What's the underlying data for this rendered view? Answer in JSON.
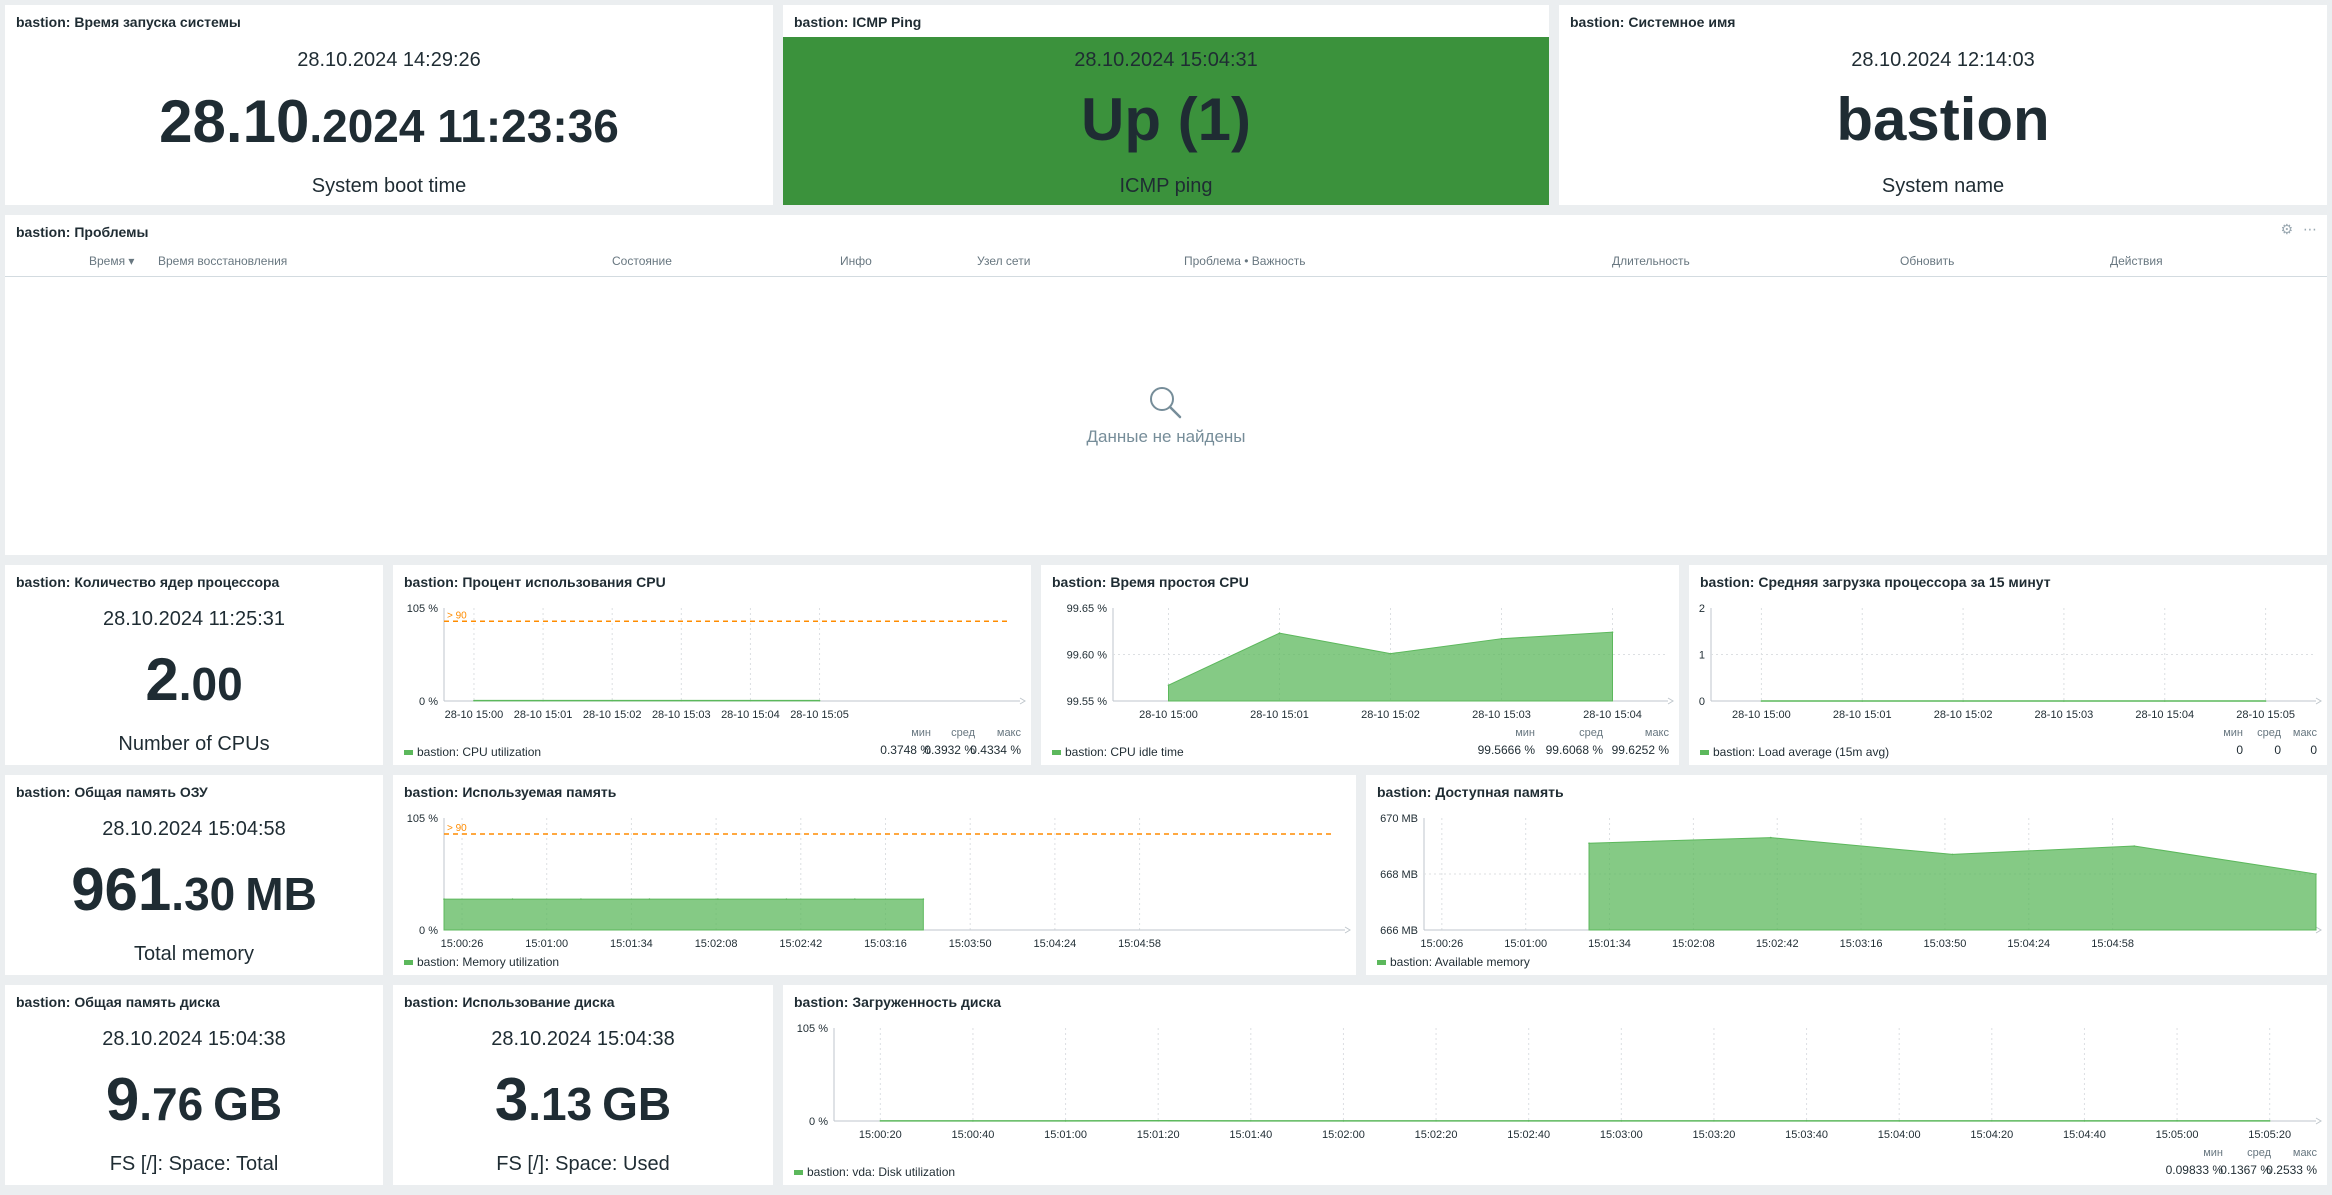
{
  "host": "bastion",
  "colors": {
    "accent_green": "#3b923c",
    "series_green": "#5cb85c",
    "threshold_orange": "#ff8c00"
  },
  "boot": {
    "title": "bastion: Время запуска системы",
    "ts": "28.10.2024 14:29:26",
    "big_main": "28.10",
    "big_small": ".2024 11:23:36",
    "desc": "System boot time"
  },
  "ping": {
    "title": "bastion: ICMP Ping",
    "ts": "28.10.2024 15:04:31",
    "big_main": "Up (1)",
    "desc": "ICMP ping"
  },
  "sysname": {
    "title": "bastion: Системное имя",
    "ts": "28.10.2024 12:14:03",
    "big_main": "bastion",
    "desc": "System name"
  },
  "problems": {
    "title": "bastion: Проблемы",
    "columns": {
      "time": "Время ▾",
      "recovery": "Время восстановления",
      "status": "Состояние",
      "info": "Инфо",
      "host": "Узел сети",
      "problem": "Проблема • Важность",
      "duration": "Длительность",
      "update": "Обновить",
      "actions": "Действия"
    },
    "empty": "Данные не найдены",
    "icons": [
      "gear-icon",
      "more-icon"
    ]
  },
  "cpu_count": {
    "title": "bastion: Количество ядер процессора",
    "ts": "28.10.2024 11:25:31",
    "big_main": "2",
    "big_small": ".00",
    "desc": "Number of CPUs"
  },
  "cpu_util": {
    "title": "bastion: Процент использования CPU",
    "legend": "bastion: CPU utilization",
    "stats": {
      "min_label": "мин",
      "avg_label": "сред",
      "max_label": "макс",
      "min": "0.3748 %",
      "avg": "0.3932 %",
      "max": "0.4334 %"
    }
  },
  "cpu_idle": {
    "title": "bastion: Время простоя CPU",
    "legend": "bastion: CPU idle time",
    "stats": {
      "min_label": "мин",
      "avg_label": "сред",
      "max_label": "макс",
      "min": "99.5666 %",
      "avg": "99.6068 %",
      "max": "99.6252 %"
    }
  },
  "load15": {
    "title": "bastion: Средняя загрузка процессора за 15 минут",
    "legend": "bastion: Load average (15m avg)",
    "stats": {
      "min_label": "мин",
      "avg_label": "сред",
      "max_label": "макс",
      "min": "0",
      "avg": "0",
      "max": "0"
    }
  },
  "total_mem": {
    "title": "bastion: Общая память ОЗУ",
    "ts": "28.10.2024 15:04:58",
    "big_main": "961",
    "big_small": ".30",
    "big_unit": "MB",
    "desc": "Total memory"
  },
  "mem_used": {
    "title": "bastion: Используемая память",
    "legend": "bastion: Memory utilization"
  },
  "mem_avail": {
    "title": "bastion: Доступная память",
    "legend": "bastion: Available memory"
  },
  "disk_total": {
    "title": "bastion: Общая память диска",
    "ts": "28.10.2024 15:04:38",
    "big_main": "9",
    "big_small": ".76",
    "big_unit": "GB",
    "desc": "FS [/]: Space: Total"
  },
  "disk_used": {
    "title": "bastion: Использование диска",
    "ts": "28.10.2024 15:04:38",
    "big_main": "3",
    "big_small": ".13",
    "big_unit": "GB",
    "desc": "FS [/]: Space: Used"
  },
  "disk_util": {
    "title": "bastion: Загруженность диска",
    "legend": "bastion: vda: Disk utilization",
    "stats": {
      "min_label": "мин",
      "avg_label": "сред",
      "max_label": "макс",
      "min": "0.09833 %",
      "avg": "0.1367 %",
      "max": "0.2533 %"
    }
  },
  "chart_data": [
    {
      "id": "cpu_util",
      "type": "line",
      "x": [
        "28-10 15:00",
        "28-10 15:01",
        "28-10 15:02",
        "28-10 15:03",
        "28-10 15:04",
        "28-10 15:05"
      ],
      "yticks": [
        "105 %",
        "0 %"
      ],
      "ylim": [
        0,
        105
      ],
      "threshold": {
        "label": "> 90",
        "value": 90
      },
      "series": [
        {
          "name": "bastion: CPU utilization",
          "values": [
            0.39,
            0.38,
            0.4,
            0.43,
            0.39,
            0.38
          ]
        }
      ]
    },
    {
      "id": "cpu_idle",
      "type": "area",
      "x": [
        "28-10 15:00",
        "28-10 15:01",
        "28-10 15:02",
        "28-10 15:03",
        "28-10 15:04"
      ],
      "yticks": [
        "99.65 %",
        "99.60 %",
        "99.55 %"
      ],
      "ylim": [
        99.55,
        99.65
      ],
      "series": [
        {
          "name": "bastion: CPU idle time",
          "values": [
            99.567,
            99.623,
            99.601,
            99.617,
            99.624
          ]
        }
      ]
    },
    {
      "id": "load15",
      "type": "line",
      "x": [
        "28-10 15:00",
        "28-10 15:01",
        "28-10 15:02",
        "28-10 15:03",
        "28-10 15:04",
        "28-10 15:05"
      ],
      "yticks": [
        "2",
        "1",
        "0"
      ],
      "ylim": [
        0,
        2
      ],
      "series": [
        {
          "name": "bastion: Load average (15m avg)",
          "values": [
            0,
            0,
            0,
            0,
            0,
            0
          ]
        }
      ]
    },
    {
      "id": "mem_used",
      "type": "area",
      "x": [
        "15:00:26",
        "15:01:00",
        "15:01:34",
        "15:02:08",
        "15:02:42",
        "15:03:16",
        "15:03:50",
        "15:04:24",
        "15:04:58"
      ],
      "yticks": [
        "105 %",
        "0 %"
      ],
      "ylim": [
        0,
        105
      ],
      "threshold": {
        "label": "> 90",
        "value": 90
      },
      "series": [
        {
          "name": "bastion: Memory utilization",
          "values": [
            29,
            29,
            29,
            29,
            29,
            29,
            29,
            29
          ]
        }
      ]
    },
    {
      "id": "mem_avail",
      "type": "area",
      "x": [
        "15:00:26",
        "15:01:00",
        "15:01:34",
        "15:02:08",
        "15:02:42",
        "15:03:16",
        "15:03:50",
        "15:04:24",
        "15:04:58"
      ],
      "yticks": [
        "670 MB",
        "668 MB",
        "666 MB"
      ],
      "ylim": [
        666,
        670
      ],
      "series": [
        {
          "name": "bastion: Available memory",
          "values": [
            669.1,
            669.3,
            668.7,
            669.0,
            668.0
          ]
        }
      ]
    },
    {
      "id": "disk_util",
      "type": "line",
      "x": [
        "15:00:20",
        "15:00:40",
        "15:01:00",
        "15:01:20",
        "15:01:40",
        "15:02:00",
        "15:02:20",
        "15:02:40",
        "15:03:00",
        "15:03:20",
        "15:03:40",
        "15:04:00",
        "15:04:20",
        "15:04:40",
        "15:05:00",
        "15:05:20"
      ],
      "yticks": [
        "105 %",
        "0 %"
      ],
      "ylim": [
        0,
        105
      ],
      "series": [
        {
          "name": "bastion: vda: Disk utilization",
          "values": [
            0.14,
            0.12,
            0.1,
            0.25,
            0.13,
            0.11,
            0.14,
            0.12,
            0.1,
            0.15,
            0.13,
            0.12,
            0.14,
            0.11,
            0.16,
            0.13
          ]
        }
      ]
    }
  ]
}
